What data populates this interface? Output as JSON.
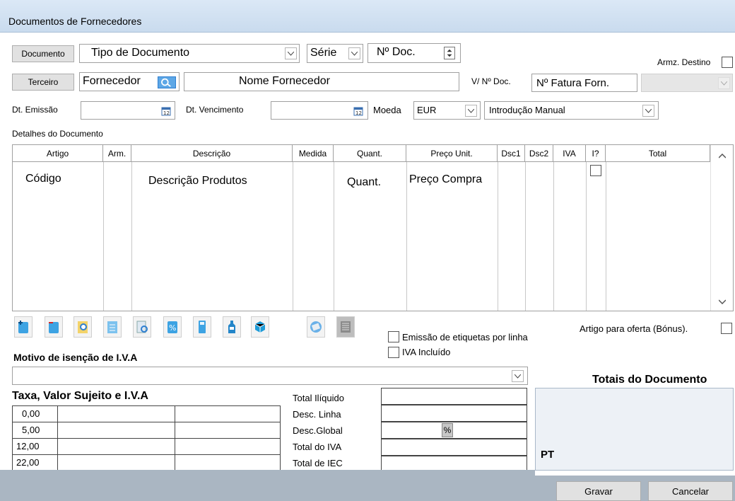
{
  "window": {
    "title": "Documentos de Fornecedores"
  },
  "header": {
    "documento_button": "Documento",
    "tipo_documento": "Tipo de Documento",
    "serie_label": "Série",
    "n_doc": "Nº Doc.",
    "armz_destino_label": "Armz. Destino",
    "terceiro_button": "Terceiro",
    "fornecedor_value": "Fornecedor",
    "nome_fornecedor": "Nome Fornecedor",
    "v_n_doc_label": "V/ Nº Doc.",
    "n_fatura_forn": "Nº Fatura Forn.",
    "dt_emissao_label": "Dt. Emissão",
    "dt_vencimento_label": "Dt. Vencimento",
    "moeda_label": "Moeda",
    "moeda_value": "EUR",
    "introducao_value": "Introdução Manual"
  },
  "details": {
    "section_label": "Detalhes do Documento",
    "columns": [
      "Artigo",
      "Arm.",
      "Descrição",
      "Medida",
      "Quant.",
      "Preço Unit.",
      "Dsc1",
      "Dsc2",
      "IVA",
      "I?",
      "Total"
    ],
    "row": {
      "artigo": "Código",
      "descricao": "Descrição Produtos",
      "quant": "Quant.",
      "preco": "Preço Compra"
    }
  },
  "options": {
    "artigo_oferta": "Artigo para oferta (Bónus).",
    "emissao_etiquetas": "Emissão de etiquetas por linha",
    "iva_incluido": "IVA Incluído"
  },
  "iva": {
    "motivo_label": "Motivo de isenção de I.V.A",
    "taxa_title": "Taxa, Valor Sujeito e I.V.A",
    "rates": [
      "0,00",
      "5,00",
      "12,00",
      "22,00"
    ]
  },
  "totals": {
    "labels": [
      "Total Ilíquido",
      "Desc. Linha",
      "Desc.Global",
      "Total do IVA",
      "Total de IEC"
    ],
    "percent_sign": "%",
    "title": "Totais do Documento",
    "country": "PT"
  },
  "actions": {
    "gravar": "Gravar",
    "cancelar": "Cancelar"
  },
  "colors": {
    "titlebar": "#cfdff0",
    "accent": "#2e7fd1",
    "bottom_bar": "#aab6c2"
  }
}
